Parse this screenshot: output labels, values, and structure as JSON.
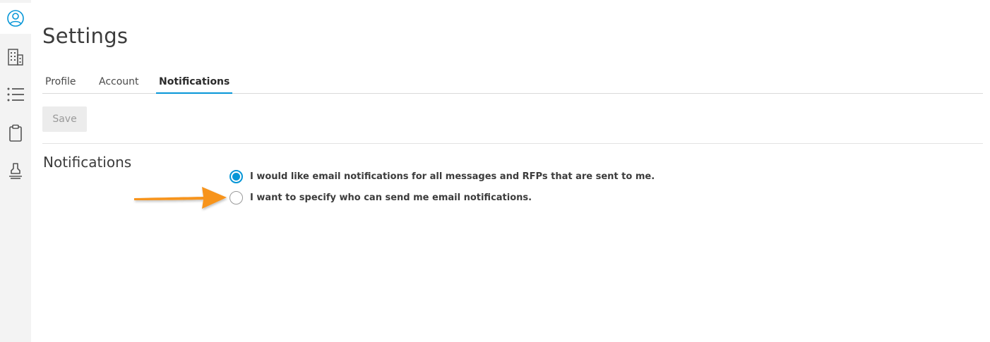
{
  "sidebar": {
    "items": [
      {
        "icon": "user-circle-icon",
        "active": true
      },
      {
        "icon": "building-icon",
        "active": false
      },
      {
        "icon": "list-icon",
        "active": false
      },
      {
        "icon": "clipboard-icon",
        "active": false
      },
      {
        "icon": "stamp-icon",
        "active": false
      }
    ]
  },
  "page": {
    "title": "Settings"
  },
  "tabs": [
    {
      "label": "Profile"
    },
    {
      "label": "Account"
    },
    {
      "label": "Notifications",
      "active": true
    }
  ],
  "toolbar": {
    "save_label": "Save"
  },
  "notifications": {
    "section_title": "Notifications",
    "options": [
      {
        "label": "I would like email notifications for all messages and RFPs that are sent to me.",
        "checked": true
      },
      {
        "label": "I want to specify who can send me email notifications.",
        "checked": false
      }
    ]
  },
  "annotation": {
    "arrow_color": "#f7941d"
  },
  "colors": {
    "accent": "#0696d7",
    "sidebar_bg": "#f3f3f3"
  }
}
